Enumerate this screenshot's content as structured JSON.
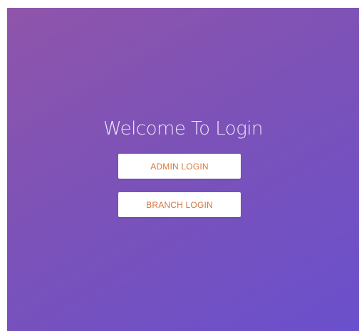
{
  "welcome": {
    "title": "Welcome To Login"
  },
  "buttons": {
    "admin_label": "ADMIN LOGIN",
    "branch_label": "BRANCH LOGIN"
  },
  "colors": {
    "background_start": "#8f55aa",
    "background_end": "#6a50cc",
    "button_text": "#d9773a",
    "button_bg": "#ffffff",
    "title_text": "#ece6f7"
  }
}
